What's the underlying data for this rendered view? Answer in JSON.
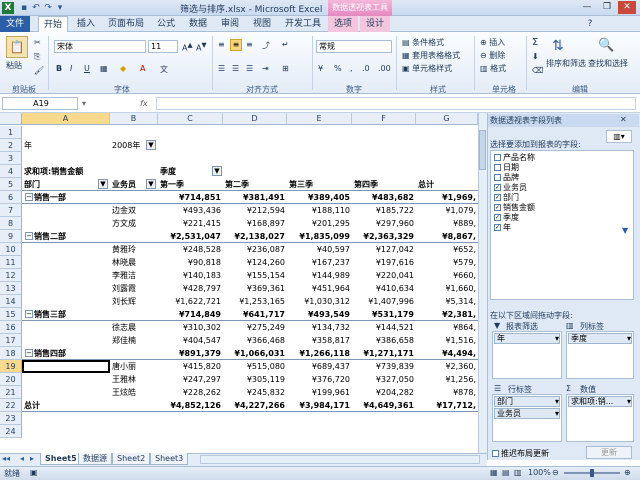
{
  "window": {
    "title": "筛选与排序.xlsx - Microsoft Excel",
    "context_group": "数据透视表工具"
  },
  "tabs": {
    "file": "文件",
    "items": [
      "开始",
      "插入",
      "页面布局",
      "公式",
      "数据",
      "审阅",
      "视图",
      "开发工具",
      "选项",
      "设计"
    ]
  },
  "ribbon": {
    "paste": "粘贴",
    "clipboard": "剪贴板",
    "font_name": "宋体",
    "font_size": "11",
    "font_group": "字体",
    "align_group": "对齐方式",
    "number_format": "常规",
    "number_group": "数字",
    "cond_format": "条件格式",
    "table_format": "套用表格格式",
    "cell_style": "单元格样式",
    "style_group": "样式",
    "insert": "插入",
    "delete": "删除",
    "format": "格式",
    "cells_group": "单元格",
    "sort_filter": "排序和筛选",
    "find_select": "查找和选择",
    "edit_group": "编辑",
    "sum_symbol": "Σ"
  },
  "formula_bar": {
    "name_box": "A19",
    "fx": "fx",
    "content": ""
  },
  "columns": [
    "A",
    "B",
    "C",
    "D",
    "E",
    "F",
    "G"
  ],
  "rows": [
    {
      "n": "1",
      "cells": [
        "",
        "",
        "",
        "",
        "",
        "",
        ""
      ]
    },
    {
      "n": "2",
      "cells": [
        "年",
        "2008年",
        "",
        "",
        "",
        "",
        ""
      ]
    },
    {
      "n": "3",
      "cells": [
        "",
        "",
        "",
        "",
        "",
        "",
        ""
      ]
    },
    {
      "n": "4",
      "cells": [
        "求和项:销售金额",
        "",
        "季度",
        "",
        "",
        "",
        ""
      ]
    },
    {
      "n": "5",
      "cells": [
        "部门",
        "业务员",
        "第一季",
        "第二季",
        "第三季",
        "第四季",
        "总计"
      ]
    },
    {
      "n": "6",
      "cells": [
        "销售一部",
        "",
        "¥714,851",
        "¥381,491",
        "¥389,405",
        "¥483,682",
        "¥1,969,"
      ]
    },
    {
      "n": "7",
      "cells": [
        "",
        "边金双",
        "¥493,436",
        "¥212,594",
        "¥188,110",
        "¥185,722",
        "¥1,079,"
      ]
    },
    {
      "n": "8",
      "cells": [
        "",
        "方文成",
        "¥221,415",
        "¥168,897",
        "¥201,295",
        "¥297,960",
        "¥889,"
      ]
    },
    {
      "n": "9",
      "cells": [
        "销售二部",
        "",
        "¥2,531,047",
        "¥2,138,027",
        "¥1,835,099",
        "¥2,363,329",
        "¥8,867,"
      ]
    },
    {
      "n": "10",
      "cells": [
        "",
        "黄雅玲",
        "¥248,528",
        "¥236,087",
        "¥40,597",
        "¥127,042",
        "¥652,"
      ]
    },
    {
      "n": "11",
      "cells": [
        "",
        "林晓晨",
        "¥90,818",
        "¥124,260",
        "¥167,237",
        "¥197,616",
        "¥579,"
      ]
    },
    {
      "n": "12",
      "cells": [
        "",
        "李雅洁",
        "¥140,183",
        "¥155,154",
        "¥144,989",
        "¥220,041",
        "¥660,"
      ]
    },
    {
      "n": "13",
      "cells": [
        "",
        "刘露霞",
        "¥428,797",
        "¥369,361",
        "¥451,964",
        "¥410,634",
        "¥1,660,"
      ]
    },
    {
      "n": "14",
      "cells": [
        "",
        "刘长辉",
        "¥1,622,721",
        "¥1,253,165",
        "¥1,030,312",
        "¥1,407,996",
        "¥5,314,"
      ]
    },
    {
      "n": "15",
      "cells": [
        "销售三部",
        "",
        "¥714,849",
        "¥641,717",
        "¥493,549",
        "¥531,179",
        "¥2,381,"
      ]
    },
    {
      "n": "16",
      "cells": [
        "",
        "徐志晨",
        "¥310,302",
        "¥275,249",
        "¥134,732",
        "¥144,521",
        "¥864,"
      ]
    },
    {
      "n": "17",
      "cells": [
        "",
        "郑佳楠",
        "¥404,547",
        "¥366,468",
        "¥358,817",
        "¥386,658",
        "¥1,516,"
      ]
    },
    {
      "n": "18",
      "cells": [
        "销售四部",
        "",
        "¥891,379",
        "¥1,066,031",
        "¥1,266,118",
        "¥1,271,171",
        "¥4,494,"
      ]
    },
    {
      "n": "19",
      "cells": [
        "",
        "唐小丽",
        "¥415,820",
        "¥515,080",
        "¥689,437",
        "¥739,839",
        "¥2,360,"
      ]
    },
    {
      "n": "20",
      "cells": [
        "",
        "王雅林",
        "¥247,297",
        "¥305,119",
        "¥376,720",
        "¥327,050",
        "¥1,256,"
      ]
    },
    {
      "n": "21",
      "cells": [
        "",
        "王炫皓",
        "¥228,262",
        "¥245,832",
        "¥199,961",
        "¥204,282",
        "¥878,"
      ]
    },
    {
      "n": "22",
      "cells": [
        "总计",
        "",
        "¥4,852,126",
        "¥4,227,266",
        "¥3,984,171",
        "¥4,649,361",
        "¥17,712,"
      ]
    },
    {
      "n": "23",
      "cells": [
        "",
        "",
        "",
        "",
        "",
        "",
        ""
      ]
    },
    {
      "n": "24",
      "cells": [
        "",
        "",
        "",
        "",
        "",
        "",
        ""
      ]
    }
  ],
  "sheet_tabs": [
    "Sheet5",
    "数据源",
    "Sheet2",
    "Sheet3"
  ],
  "status": {
    "ready": "就绪",
    "zoom": "100%"
  },
  "panel": {
    "title": "数据透视表字段列表",
    "choose_label": "选择要添加到报表的字段:",
    "fields": [
      {
        "name": "产品名称",
        "checked": false
      },
      {
        "name": "日期",
        "checked": false
      },
      {
        "name": "品牌",
        "checked": false
      },
      {
        "name": "业务员",
        "checked": true
      },
      {
        "name": "部门",
        "checked": true
      },
      {
        "name": "销售金额",
        "checked": true
      },
      {
        "name": "季度",
        "checked": true
      },
      {
        "name": "年",
        "checked": true
      }
    ],
    "drag_label": "在以下区域间拖动字段:",
    "report_filter": "报表筛选",
    "column_labels": "列标签",
    "row_labels": "行标签",
    "values": "数值",
    "filter_items": [
      "年"
    ],
    "column_items": [
      "季度"
    ],
    "row_items": [
      "部门",
      "业务员"
    ],
    "value_items": [
      "求和项:销..."
    ],
    "defer_update": "推迟布局更新",
    "update": "更新"
  }
}
